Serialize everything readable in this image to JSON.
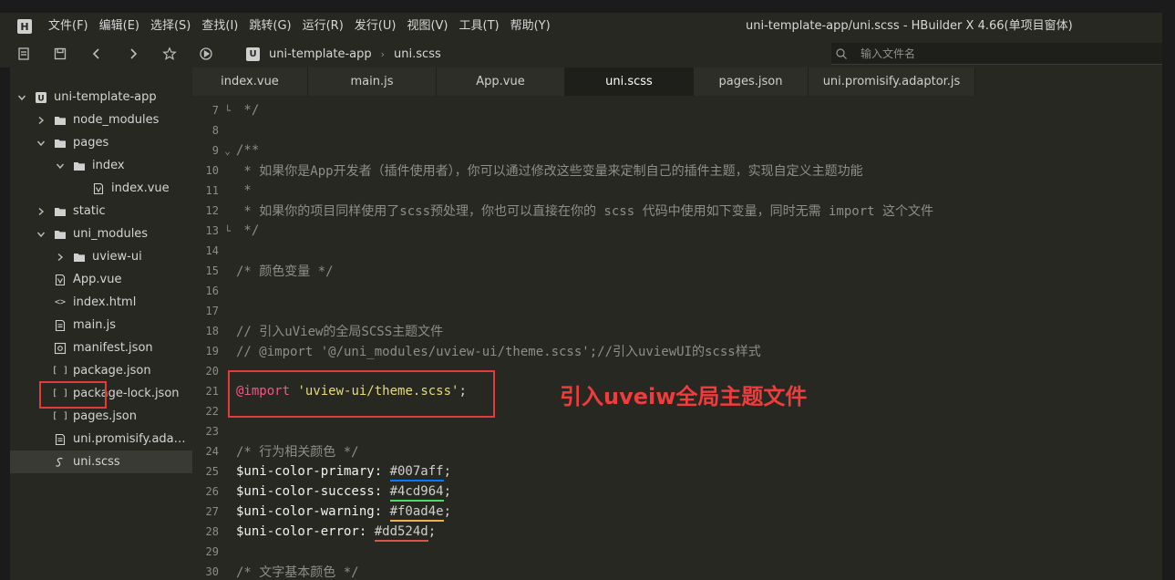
{
  "menubar": {
    "logo": "H",
    "items": [
      "文件(F)",
      "编辑(E)",
      "选择(S)",
      "查找(I)",
      "跳转(G)",
      "运行(R)",
      "发行(U)",
      "视图(V)",
      "工具(T)",
      "帮助(Y)"
    ],
    "window_title": "uni-template-app/uni.scss - HBuilder X 4.66(单项目窗体)"
  },
  "toolbar": {
    "icons": [
      "new-file-icon",
      "save-icon",
      "back-icon",
      "forward-icon",
      "favorite-icon",
      "run-icon"
    ],
    "breadcrumb": {
      "logo": "U",
      "project": "uni-template-app",
      "file": "uni.scss"
    },
    "search_placeholder": "输入文件名"
  },
  "sidebar": {
    "items": [
      {
        "label": "uni-template-app",
        "type": "project",
        "depth": 0,
        "expanded": true
      },
      {
        "label": "node_modules",
        "type": "folder",
        "depth": 1,
        "expanded": false
      },
      {
        "label": "pages",
        "type": "folder",
        "depth": 1,
        "expanded": true
      },
      {
        "label": "index",
        "type": "folder",
        "depth": 2,
        "expanded": true
      },
      {
        "label": "index.vue",
        "type": "vue",
        "depth": 3
      },
      {
        "label": "static",
        "type": "folder",
        "depth": 1,
        "expanded": false
      },
      {
        "label": "uni_modules",
        "type": "folder",
        "depth": 1,
        "expanded": true
      },
      {
        "label": "uview-ui",
        "type": "folder",
        "depth": 2,
        "expanded": false
      },
      {
        "label": "App.vue",
        "type": "vue",
        "depth": 1
      },
      {
        "label": "index.html",
        "type": "html",
        "depth": 1
      },
      {
        "label": "main.js",
        "type": "js",
        "depth": 1
      },
      {
        "label": "manifest.json",
        "type": "manifest",
        "depth": 1
      },
      {
        "label": "package.json",
        "type": "json",
        "depth": 1
      },
      {
        "label": "package-lock.json",
        "type": "json",
        "depth": 1
      },
      {
        "label": "pages.json",
        "type": "json",
        "depth": 1
      },
      {
        "label": "uni.promisify.adaptor.js",
        "type": "js",
        "depth": 1
      },
      {
        "label": "uni.scss",
        "type": "scss",
        "depth": 1,
        "selected": true
      }
    ]
  },
  "tabs": [
    {
      "label": "index.vue",
      "active": false
    },
    {
      "label": "main.js",
      "active": false
    },
    {
      "label": "App.vue",
      "active": false
    },
    {
      "label": "uni.scss",
      "active": true
    },
    {
      "label": "pages.json",
      "active": false
    },
    {
      "label": "uni.promisify.adaptor.js",
      "active": false
    }
  ],
  "editor": {
    "lines": [
      {
        "n": "7",
        "fold": "└",
        "tokens": [
          [
            "c-cmt",
            " */"
          ]
        ]
      },
      {
        "n": "8",
        "fold": "",
        "tokens": []
      },
      {
        "n": "9",
        "fold": "⌄",
        "tokens": [
          [
            "c-cmt",
            "/**"
          ]
        ]
      },
      {
        "n": "10",
        "fold": "",
        "tokens": [
          [
            "c-cmt",
            " * 如果你是App开发者（插件使用者），你可以通过修改这些变量来定制自己的插件主题，实现自定义主题功能"
          ]
        ]
      },
      {
        "n": "11",
        "fold": "",
        "tokens": [
          [
            "c-cmt",
            " *"
          ]
        ]
      },
      {
        "n": "12",
        "fold": "",
        "tokens": [
          [
            "c-cmt",
            " * 如果你的项目同样使用了scss预处理，你也可以直接在你的 scss 代码中使用如下变量，同时无需 import 这个文件"
          ]
        ]
      },
      {
        "n": "13",
        "fold": "└",
        "tokens": [
          [
            "c-cmt",
            " */"
          ]
        ]
      },
      {
        "n": "14",
        "fold": "",
        "tokens": []
      },
      {
        "n": "15",
        "fold": "",
        "tokens": [
          [
            "c-cmt",
            "/* 颜色变量 */"
          ]
        ]
      },
      {
        "n": "16",
        "fold": "",
        "tokens": []
      },
      {
        "n": "17",
        "fold": "",
        "tokens": []
      },
      {
        "n": "18",
        "fold": "",
        "tokens": [
          [
            "c-cmt",
            "// 引入uView的全局SCSS主题文件"
          ]
        ]
      },
      {
        "n": "19",
        "fold": "",
        "tokens": [
          [
            "c-cmt",
            "// @import '@/uni_modules/uview-ui/theme.scss';//引入uviewUI的scss样式"
          ]
        ]
      },
      {
        "n": "20",
        "fold": "",
        "tokens": []
      },
      {
        "n": "21",
        "fold": "",
        "tokens": [
          [
            "c-at",
            "@import"
          ],
          [
            "code",
            " "
          ],
          [
            "c-str",
            "'uview-ui/theme.scss'"
          ],
          [
            "code",
            ";"
          ]
        ]
      },
      {
        "n": "22",
        "fold": "",
        "tokens": []
      },
      {
        "n": "23",
        "fold": "",
        "tokens": []
      },
      {
        "n": "24",
        "fold": "",
        "tokens": [
          [
            "c-cmt",
            "/* 行为相关颜色 */"
          ]
        ]
      },
      {
        "n": "25",
        "fold": "",
        "tokens": [
          [
            "c-var",
            "$uni-color-primary: "
          ],
          [
            "hex hex-primary",
            "#007aff"
          ],
          [
            "code",
            ";"
          ]
        ]
      },
      {
        "n": "26",
        "fold": "",
        "tokens": [
          [
            "c-var",
            "$uni-color-success: "
          ],
          [
            "hex hex-success",
            "#4cd964"
          ],
          [
            "code",
            ";"
          ]
        ]
      },
      {
        "n": "27",
        "fold": "",
        "tokens": [
          [
            "c-var",
            "$uni-color-warning: "
          ],
          [
            "hex hex-warning",
            "#f0ad4e"
          ],
          [
            "code",
            ";"
          ]
        ]
      },
      {
        "n": "28",
        "fold": "",
        "tokens": [
          [
            "c-var",
            "$uni-color-error: "
          ],
          [
            "hex hex-error",
            "#dd524d"
          ],
          [
            "code",
            ";"
          ]
        ]
      },
      {
        "n": "29",
        "fold": "",
        "tokens": []
      },
      {
        "n": "30",
        "fold": "",
        "tokens": [
          [
            "c-cmt",
            "/* 文字基本颜色 */"
          ]
        ]
      }
    ],
    "annotation": "引入uveiw全局主题文件"
  },
  "colors": {
    "primary": "#007aff",
    "success": "#4cd964",
    "warning": "#f0ad4e",
    "error": "#dd524d",
    "highlight_box": "#e23b3b"
  }
}
